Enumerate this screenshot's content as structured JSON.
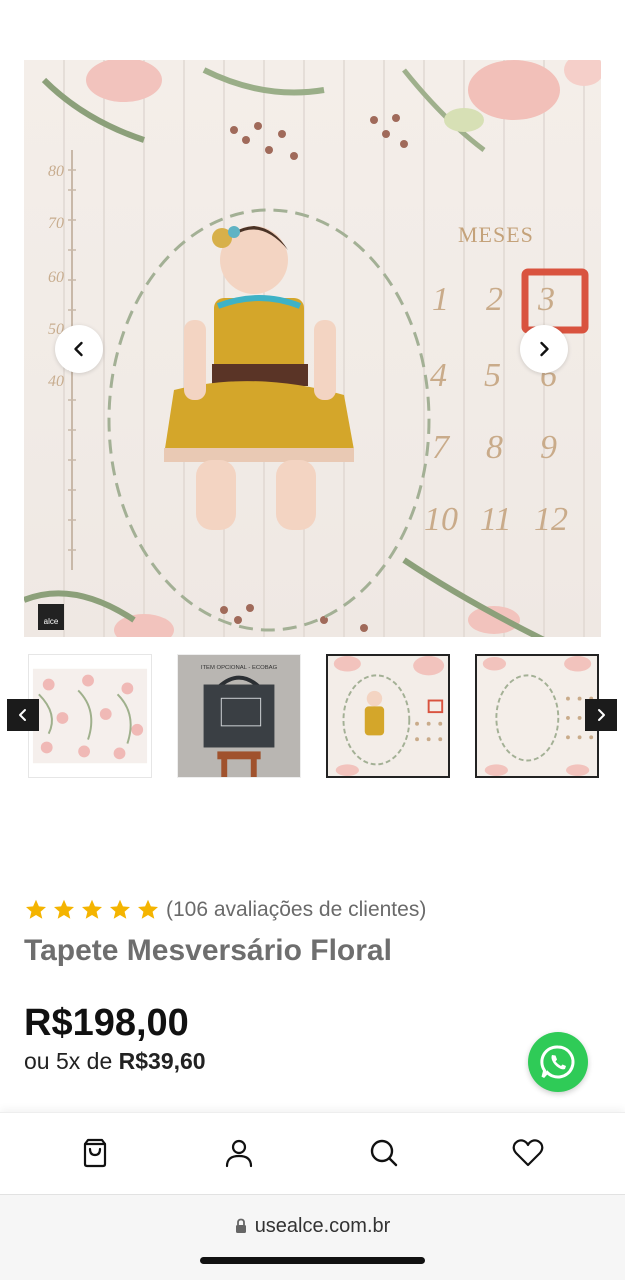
{
  "gallery": {
    "mat": {
      "months_title": "MESES",
      "month_numbers": [
        "1",
        "2",
        "3",
        "4",
        "5",
        "6",
        "7",
        "8",
        "9",
        "10",
        "11",
        "12"
      ],
      "height_marks": [
        "80",
        "70",
        "60",
        "50",
        "40"
      ],
      "brand_tag": "alce"
    },
    "thumbnails": [
      {
        "caption": ""
      },
      {
        "caption": "ITEM OPCIONAL - ECOBAG"
      },
      {
        "caption": ""
      },
      {
        "caption": ""
      }
    ]
  },
  "product": {
    "stars": 5,
    "reviews_text": "(106 avaliações de clientes)",
    "title": "Tapete Mesversário Floral",
    "price": "R$198,00",
    "installments_prefix": "ou 5x de",
    "installments_value": "R$39,60"
  },
  "browser": {
    "url": "usealce.com.br"
  },
  "colors": {
    "star": "#f4b400",
    "whatsapp": "#2fcb57",
    "accent_red": "#d9533f"
  },
  "icons": {
    "prev": "chevron-left-icon",
    "next": "chevron-right-icon",
    "bag": "shopping-bag-icon",
    "user": "user-icon",
    "search": "search-icon",
    "heart": "heart-icon",
    "whatsapp": "whatsapp-icon",
    "lock": "lock-icon"
  }
}
